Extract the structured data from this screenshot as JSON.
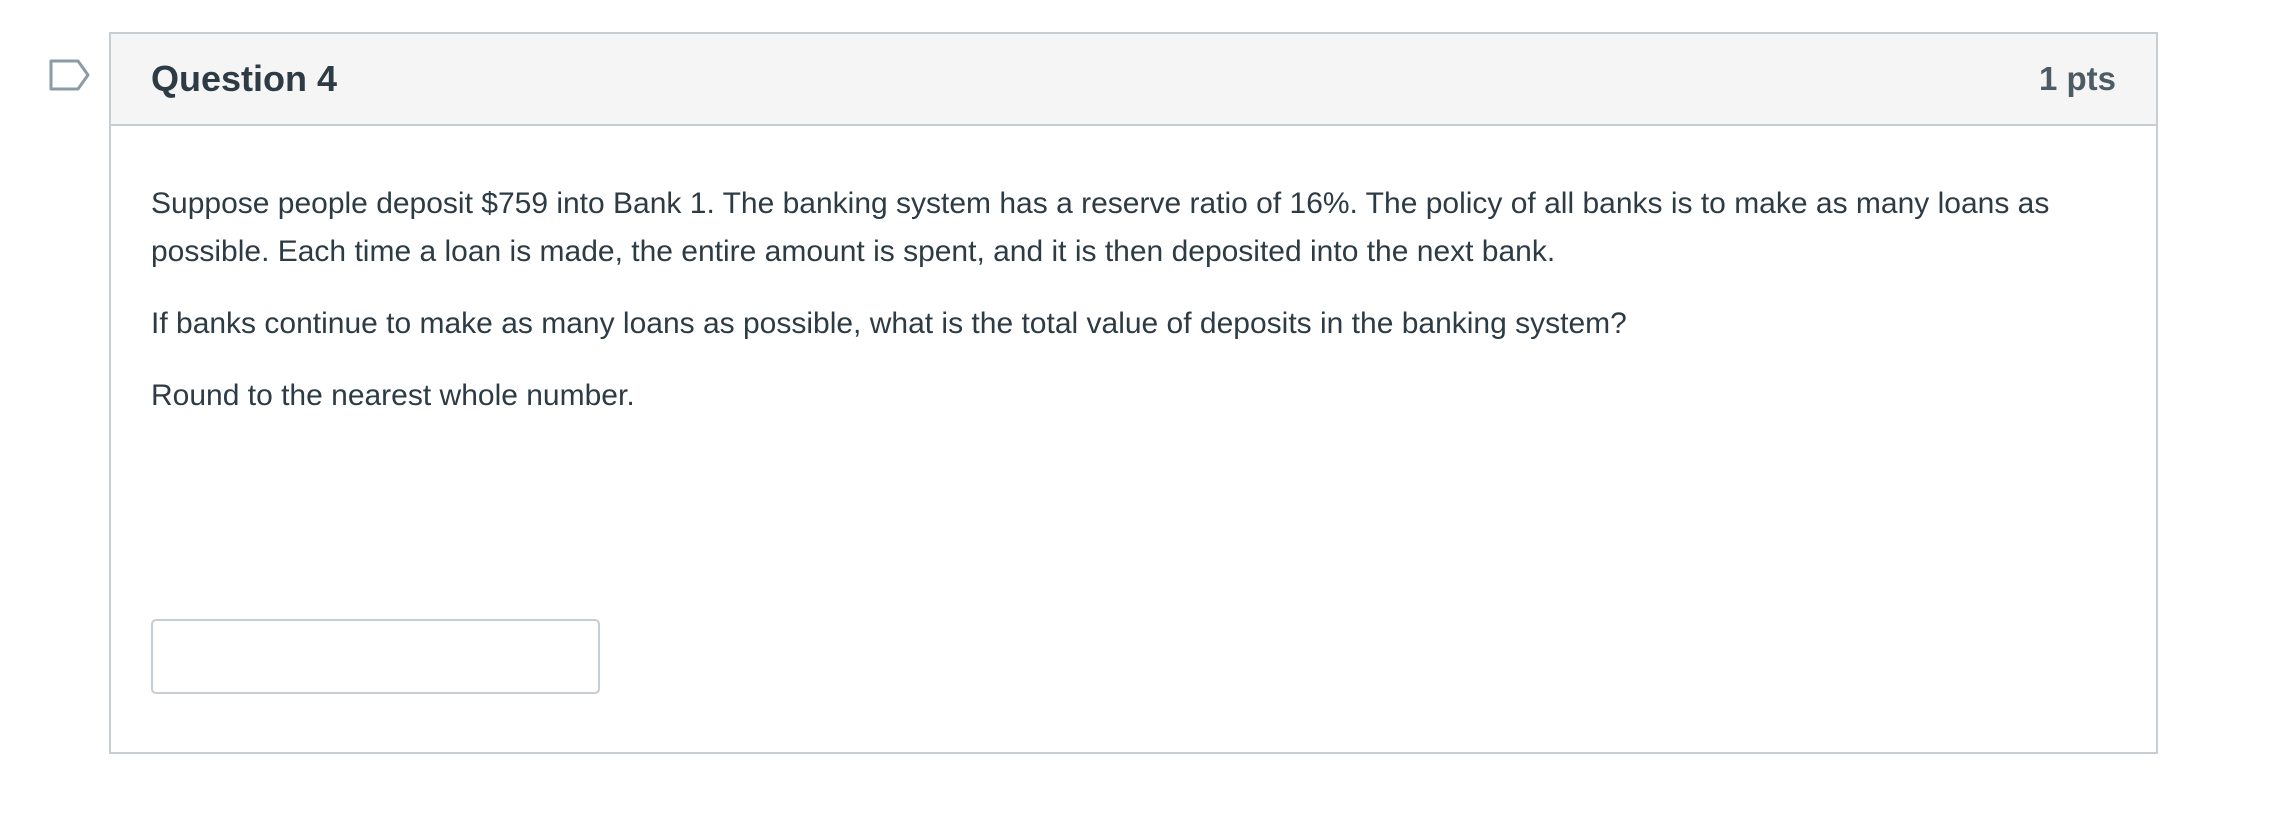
{
  "question": {
    "title": "Question 4",
    "points": "1 pts",
    "paragraphs": {
      "p1": "Suppose people deposit $759 into Bank 1.  The banking system has a reserve ratio of 16%.  The policy of all banks is to make as many loans as possible.  Each time a loan is made, the entire amount is spent, and it is then deposited into the next bank.",
      "p2": "If banks continue to make as many loans as possible, what is the total value of deposits in the banking system?",
      "p3": "Round to the nearest whole number."
    },
    "answer": {
      "value": "",
      "placeholder": ""
    }
  },
  "icons": {
    "flag": "flag-question-icon"
  },
  "colors": {
    "border": "#c7cdd1",
    "header_bg": "#f5f5f5",
    "text": "#2d3b45",
    "flag_stroke": "#8b9ba8"
  }
}
